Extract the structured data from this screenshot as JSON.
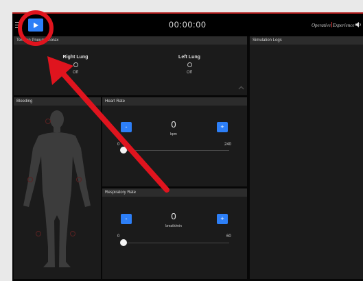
{
  "header": {
    "timer": "00:00:00",
    "logo_left": "Operative",
    "logo_right": "Experience"
  },
  "tension_pneumothorax": {
    "title": "Tension Pneumothorax",
    "lungs": [
      {
        "name": "Right Lung",
        "status": "Off"
      },
      {
        "name": "Left Lung",
        "status": "Off"
      }
    ]
  },
  "bleeding": {
    "title": "Bleeding"
  },
  "heart_rate": {
    "title": "Heart Rate",
    "minus_label": "-",
    "plus_label": "+",
    "value": "0",
    "unit": "bpm",
    "min": "0",
    "max": "240",
    "slider_fraction": 0
  },
  "respiratory_rate": {
    "title": "Respiratory Rate",
    "minus_label": "-",
    "plus_label": "+",
    "value": "0",
    "unit": "breath/min",
    "min": "0",
    "max": "60",
    "slider_fraction": 0
  },
  "simulation_logs": {
    "title": "Simulation Logs"
  },
  "colors": {
    "accent": "#2d7ff7",
    "annotation": "#e0141e",
    "panel": "#1b1b1b",
    "panel_header": "#2c2c2c"
  },
  "icons": [
    "hamburger-icon",
    "play-icon",
    "speaker-icon",
    "chevron-up-icon",
    "body-silhouette-icon"
  ]
}
